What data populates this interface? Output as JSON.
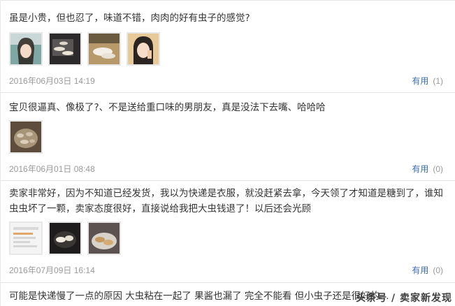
{
  "reviews": [
    {
      "text": "虽是小贵，但也忍了，味道不错，肉肉的好有虫子的感觉?",
      "photos": [
        "photo-portrait",
        "photo-larvae-dish",
        "photo-larvae-closeup",
        "photo-portrait-2"
      ],
      "date": "2016年06月03日 14:19",
      "useful_label": "有用",
      "useful_count": "(1)"
    },
    {
      "text": "宝贝很逼真、像极了?、不是送给重口味的男朋友，真是没法下去嘴、哈哈哈",
      "photos": [
        "photo-larvae-bowl"
      ],
      "date": "2016年06月01日 08:48",
      "useful_label": "有用",
      "useful_count": "(0)"
    },
    {
      "text": "卖家非常好，因为不知道已经发货，我以为快递是衣服，就没赶紧去拿，今天领了才知道是糖到了，谁知虫虫坏了一颗，卖家态度很好，直接说给我把大虫钱退了！以后还会光顾",
      "photos": [
        "photo-screenshot",
        "photo-larvae-dish-2",
        "photo-larvae-plate"
      ],
      "date": "2016年07月09日 16:14",
      "useful_label": "有用",
      "useful_count": "(0)"
    },
    {
      "text": "可能是快递慢了一点的原因 大虫粘在一起了 果酱也漏了 完全不能看 但小虫子还是很好的…"
    }
  ],
  "watermark": "头条号 / 卖家新发现"
}
